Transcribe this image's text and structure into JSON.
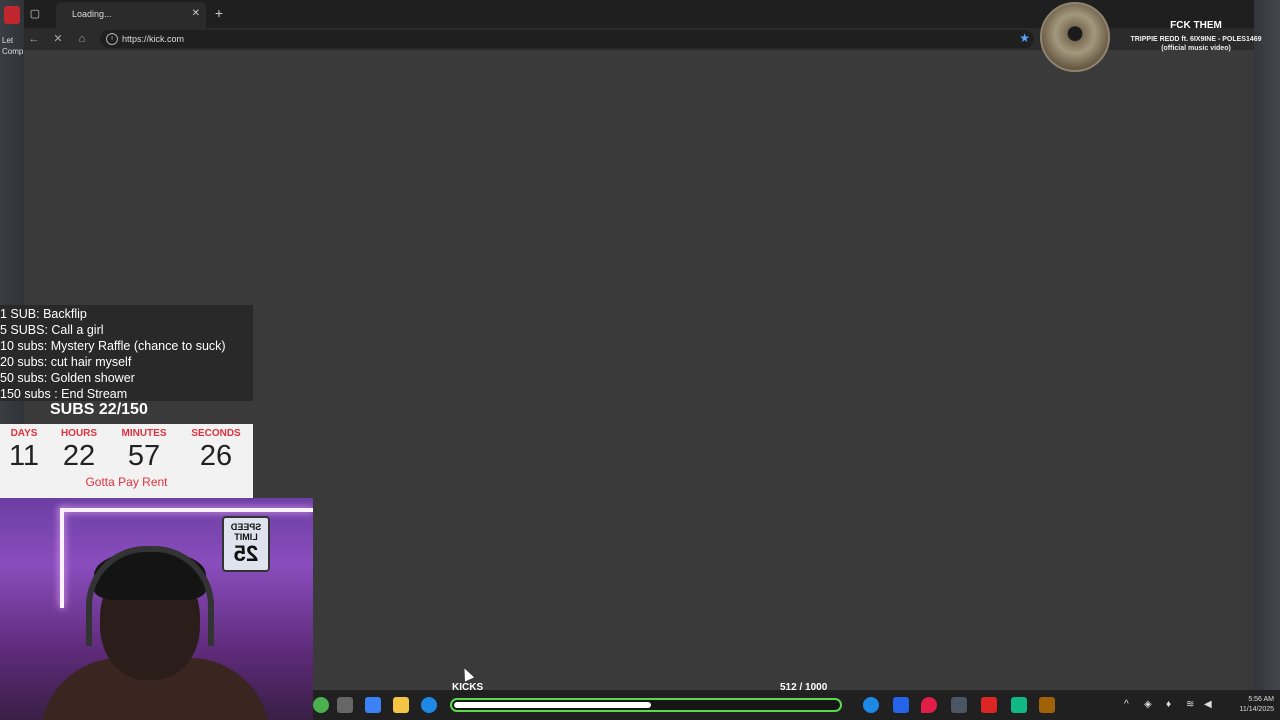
{
  "desktop": {
    "icon_labels": [
      "Let",
      "Comp"
    ]
  },
  "browser": {
    "tab_title": "Loading...",
    "url": "https://kick.com",
    "accent": "#5aa6ff"
  },
  "now_playing": {
    "title": "FCK THEM",
    "artist_line1": "TRIPPIE REDD ft. 6IX9INE - POLES1469",
    "artist_line2": "(official music video)"
  },
  "sub_goals": {
    "items": [
      "1 SUB: Backflip",
      "5 SUBS: Call a girl",
      "10 subs: Mystery Raffle (chance to suck)",
      "20 subs: cut hair myself",
      "50 subs: Golden shower",
      "150 subs : End Stream"
    ],
    "progress_text": "SUBS 22/150"
  },
  "countdown": {
    "labels": {
      "days": "DAYS",
      "hours": "HOURS",
      "minutes": "MINUTES",
      "seconds": "SECONDS"
    },
    "values": {
      "days": "11",
      "hours": "22",
      "minutes": "57",
      "seconds": "26"
    },
    "caption": "Gotta Pay Rent",
    "accent": "#e0323e"
  },
  "webcam": {
    "sign_top": "SPEED LIMIT",
    "sign_number": "25"
  },
  "kicks_goal": {
    "label": "KICKS",
    "current": 512,
    "target": 1000,
    "count_text": "512  / 1000",
    "bar_color": "#5bd94a"
  },
  "taskbar": {
    "time": "5:56 AM",
    "date": "11/14/2025"
  }
}
